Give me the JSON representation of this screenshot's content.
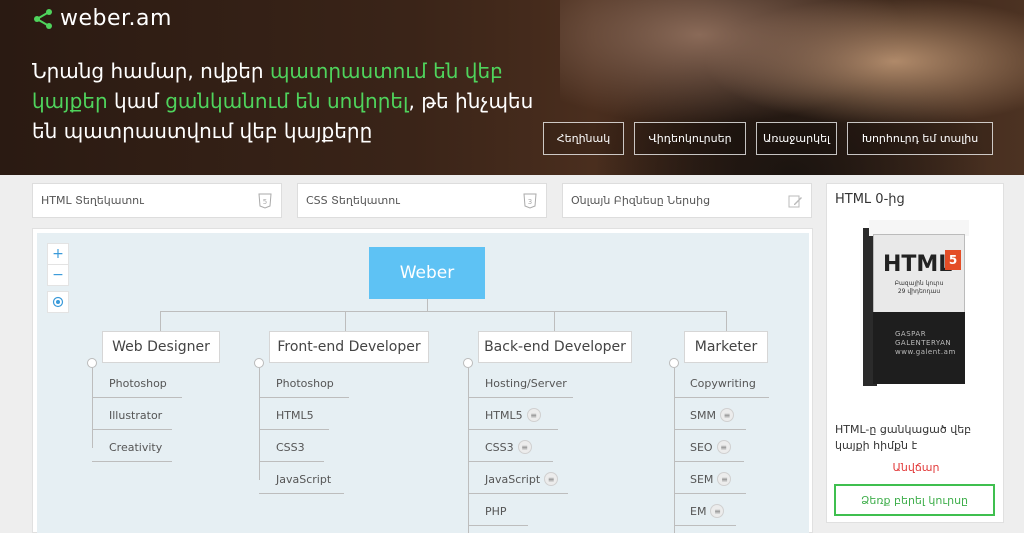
{
  "brand": {
    "name": "weber.am",
    "accent": "#4fd45c"
  },
  "hero": {
    "line1_a": "Նրանց համար, ովքեր ",
    "line1_hl": "պատրաստում են վեբ",
    "line2_hl1": "կայքեր",
    "line2_a": " կամ ",
    "line2_hl2": "ցանկանում են սովորել",
    "line2_b": ", թե ինչպես",
    "line3": "են պատրաստվում վեբ կայքերը",
    "buttons": [
      "Հեղինակ",
      "Վիդեոկուրսեր",
      "Առաջարկել",
      "Խորհուրդ եմ տալիս"
    ]
  },
  "search": {
    "html": "HTML Տեղեկատու",
    "css": "CSS Տեղեկատու",
    "test": "Օնլայն Բիզնեսը Ներսից"
  },
  "map": {
    "root": "Weber",
    "branches": [
      {
        "label": "Web Designer",
        "items": [
          "Photoshop",
          "Illustrator",
          "Creativity"
        ]
      },
      {
        "label": "Front-end Developer",
        "items": [
          "Photoshop",
          "HTML5",
          "CSS3",
          "JavaScript"
        ]
      },
      {
        "label": "Back-end Developer",
        "items": [
          "Hosting/Server",
          "HTML5",
          "CSS3",
          "JavaScript",
          "PHP"
        ]
      },
      {
        "label": "Marketer",
        "items": [
          "Copywriting",
          "SMM",
          "SEO",
          "SEM",
          "EM"
        ]
      }
    ],
    "zoom_in": "+",
    "zoom_out": "−"
  },
  "course": {
    "title": "HTML 0-ից",
    "box_title": "HTML",
    "box_badge": "5",
    "box_sub": "Բազային կուրս\n29 վիդեոդաս",
    "box_brand": "GASPAR\nGALENTERYAN\nwww.galent.am",
    "desc": "HTML-ը ցանկացած վեբ կայքի հիմքն է",
    "price": "Անվճար",
    "cta": "Ձեռք բերել կուրսը"
  }
}
